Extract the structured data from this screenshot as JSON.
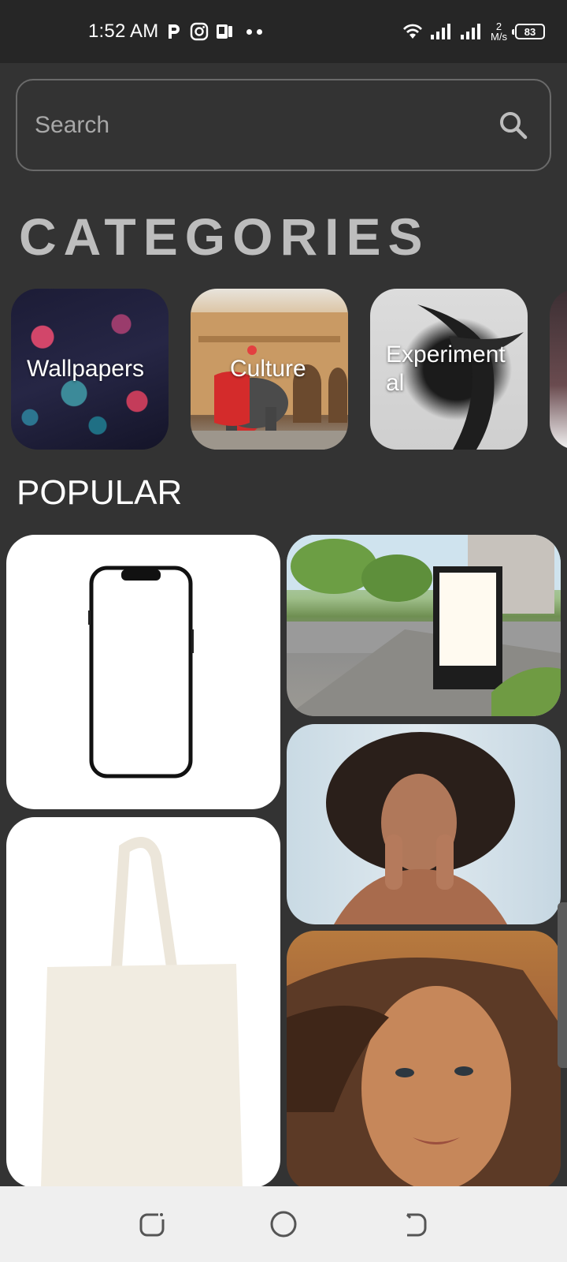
{
  "status_bar": {
    "time": "1:52 AM",
    "net_speed_value": "2",
    "net_speed_unit": "M/s",
    "battery": "83",
    "icons": [
      "p-app-icon",
      "instagram-icon",
      "docs-icon",
      "more-dots-icon",
      "wifi-icon",
      "signal-icon",
      "signal-icon",
      "battery-icon"
    ]
  },
  "search": {
    "placeholder": "Search",
    "icon": "search-icon"
  },
  "categories": {
    "title": "CATEGORIES",
    "items": [
      {
        "label": "Wallpapers"
      },
      {
        "label": "Culture"
      },
      {
        "label": "Experimental"
      }
    ]
  },
  "popular": {
    "title": "POPULAR",
    "items": [
      {
        "image": "smartphone mockup"
      },
      {
        "image": "street billboard mockup"
      },
      {
        "image": "curly-haired woman portrait"
      },
      {
        "image": "tote bag mockup"
      },
      {
        "image": "woman portrait warm tones"
      }
    ]
  },
  "nav_bar": {
    "icons": [
      "recents-icon",
      "home-icon",
      "back-icon"
    ]
  },
  "colors": {
    "background": "#333333",
    "status_bar": "#262626",
    "nav_bar": "#efefef",
    "categories_title": "#bdbdbd"
  }
}
